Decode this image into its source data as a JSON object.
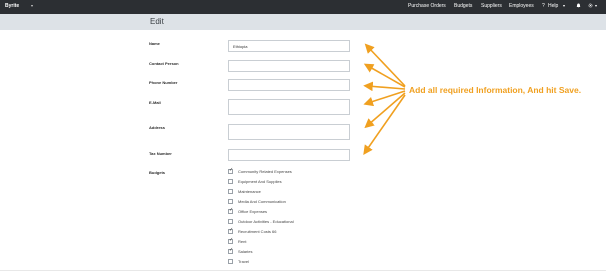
{
  "topbar": {
    "brand": "Byrite",
    "nav": [
      "Purchase Orders",
      "Budgets",
      "Suppliers",
      "Employees"
    ],
    "help": "Help",
    "icons": [
      "help-icon",
      "bell-icon",
      "gear-icon"
    ]
  },
  "page": {
    "title": "Edit"
  },
  "form": {
    "name_label": "Name",
    "name_value": "Ethiopia",
    "contact_label": "Contact Person",
    "phone_label": "Phone Number",
    "email_label": "E-Mail",
    "address_label": "Address",
    "tax_label": "Tax Number",
    "budgets_label": "Budgets"
  },
  "budgets": [
    {
      "label": "Community Related Expenses",
      "checked": true
    },
    {
      "label": "Equipment And Supplies",
      "checked": false
    },
    {
      "label": "Maintenance",
      "checked": false
    },
    {
      "label": "Media And Communication",
      "checked": false
    },
    {
      "label": "Office Expenses",
      "checked": true
    },
    {
      "label": "Outdoor Activities - Educational",
      "checked": false
    },
    {
      "label": "Recruitment Costs 66",
      "checked": true
    },
    {
      "label": "Rent",
      "checked": true
    },
    {
      "label": "Salaries",
      "checked": true
    },
    {
      "label": "Travel",
      "checked": false
    }
  ],
  "annotation": {
    "text": "Add all required Information, And hit Save."
  },
  "colors": {
    "topbar": "#2c2f33",
    "editbar": "#dde2e7",
    "annotation": "#f0a020"
  }
}
